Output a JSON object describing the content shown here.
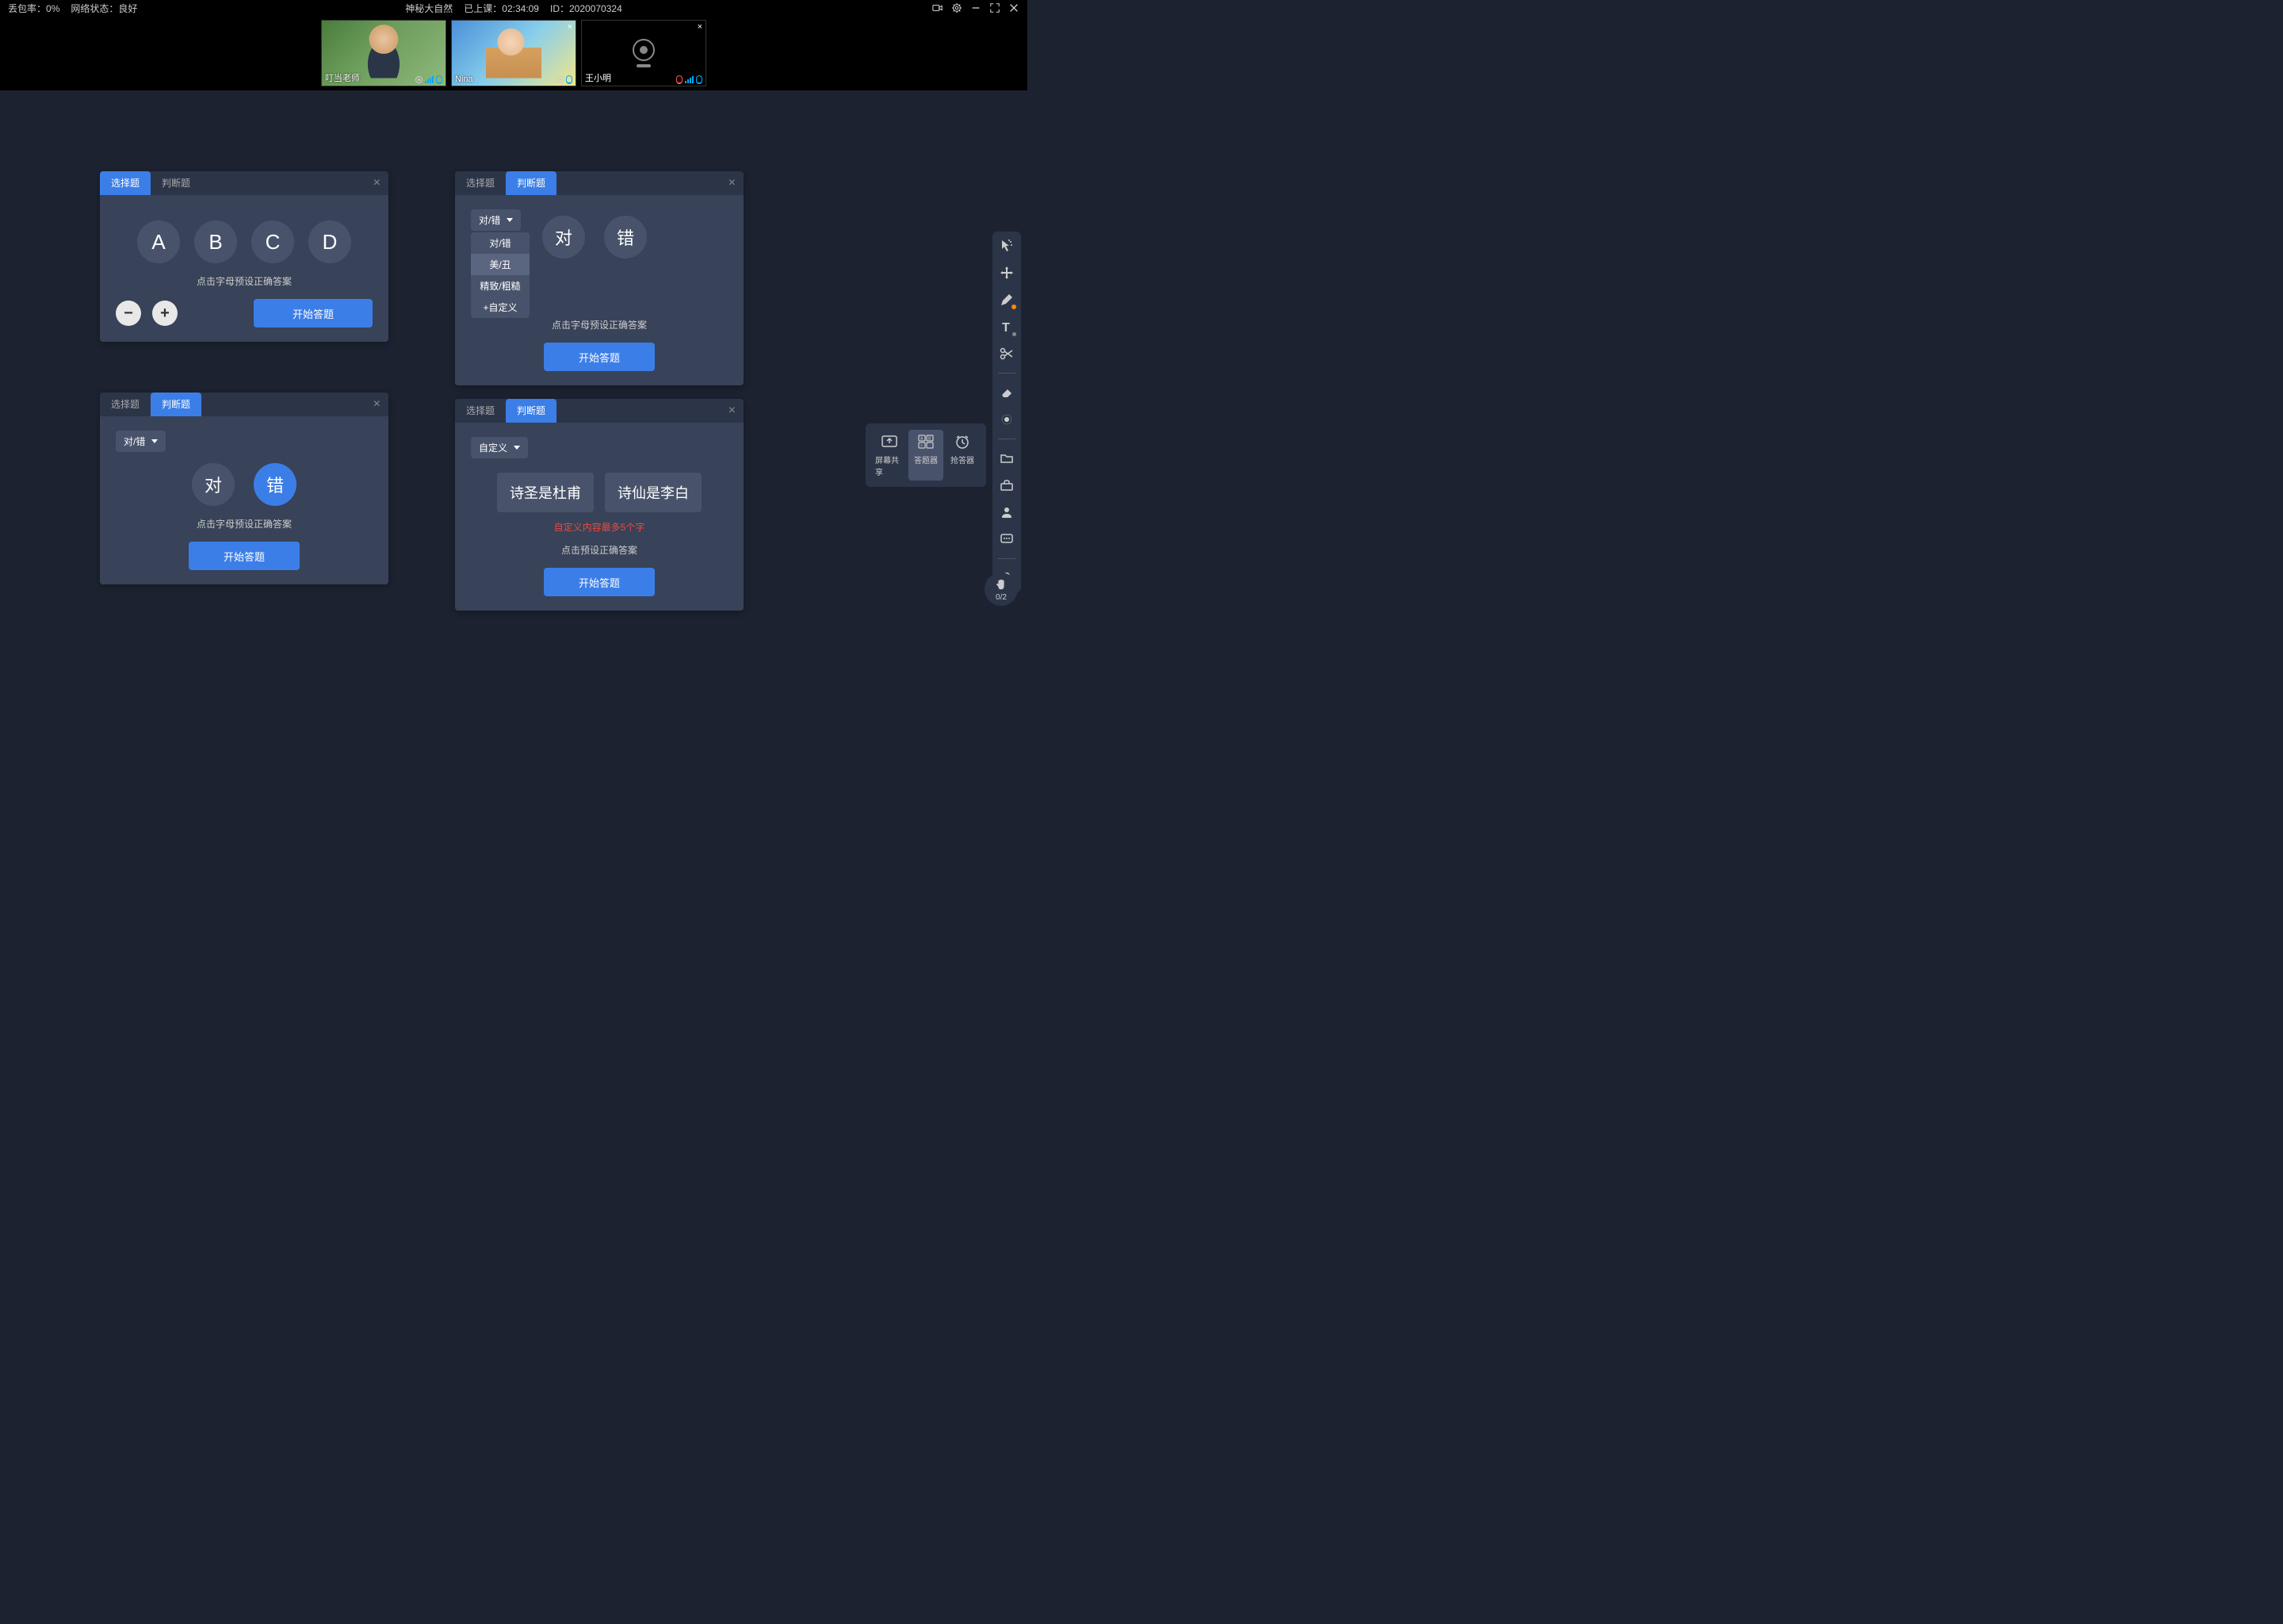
{
  "topbar": {
    "packet_loss_label": "丢包率：",
    "packet_loss_value": "0%",
    "network_label": "网络状态：",
    "network_value": "良好",
    "title": "神秘大自然",
    "class_time_label": "已上课：",
    "class_time_value": "02:34:09",
    "id_label": "ID：",
    "id_value": "2020070324"
  },
  "participants": [
    {
      "name": "叮当老师",
      "role": "teacher"
    },
    {
      "name": "Nina",
      "role": "student"
    },
    {
      "name": "王小明",
      "role": "student-nocam"
    }
  ],
  "panel1": {
    "tab1": "选择题",
    "tab2": "判断题",
    "options": [
      "A",
      "B",
      "C",
      "D"
    ],
    "hint": "点击字母预设正确答案",
    "start": "开始答题"
  },
  "panel2": {
    "tab1": "选择题",
    "tab2": "判断题",
    "dropdown_label": "对/错",
    "menu": [
      "对/错",
      "美/丑",
      "精致/粗糙",
      "+自定义"
    ],
    "options": [
      "对",
      "错"
    ],
    "hint": "点击字母预设正确答案",
    "start": "开始答题"
  },
  "panel3": {
    "tab1": "选择题",
    "tab2": "判断题",
    "dropdown_label": "对/错",
    "options": [
      "对",
      "错"
    ],
    "hint": "点击字母预设正确答案",
    "start": "开始答题"
  },
  "panel4": {
    "tab1": "选择题",
    "tab2": "判断题",
    "dropdown_label": "自定义",
    "options": [
      "诗圣是杜甫",
      "诗仙是李白"
    ],
    "error": "自定义内容最多5个字",
    "hint": "点击预设正确答案",
    "start": "开始答题"
  },
  "popup_tools": {
    "screen_share": "屏幕共享",
    "answer_tool": "答题器",
    "buzzer": "抢答器"
  },
  "hand_badge": {
    "count": "0/2"
  }
}
